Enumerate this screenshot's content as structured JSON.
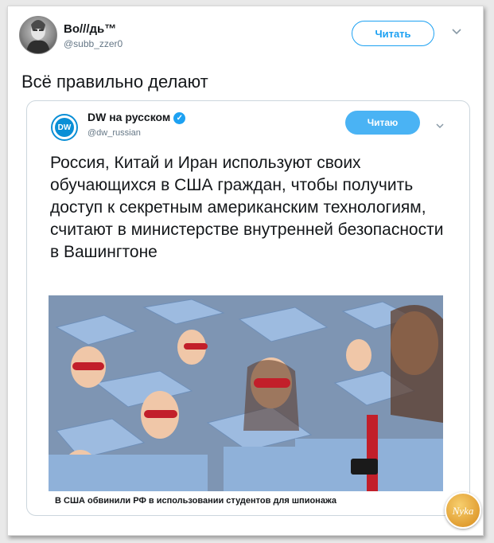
{
  "tweet": {
    "user_name": "Bo///дь™",
    "user_handle": "@subb_zzer0",
    "follow_label": "Читать",
    "text": "Всё правильно делают"
  },
  "quoted_tweet": {
    "user_name": "DW на русском",
    "user_handle": "@dw_russian",
    "logo_text": "DW",
    "follow_label": "Читаю",
    "text": "Россия, Китай и Иран используют своих обучающихся в США граждан, чтобы получить доступ к секретным американским технологиям, считают в министерстве внутренней безопасности в Вашингтоне",
    "image_caption": "В США обвинили РФ в использовании студентов для шпионажа"
  },
  "colors": {
    "accent": "#1da1f2",
    "dw_blue": "#0a8fd6",
    "graduation_gown": "#8fb1d9"
  },
  "icons": {
    "verified": "verified-badge-icon",
    "menu": "chevron-down-icon"
  }
}
